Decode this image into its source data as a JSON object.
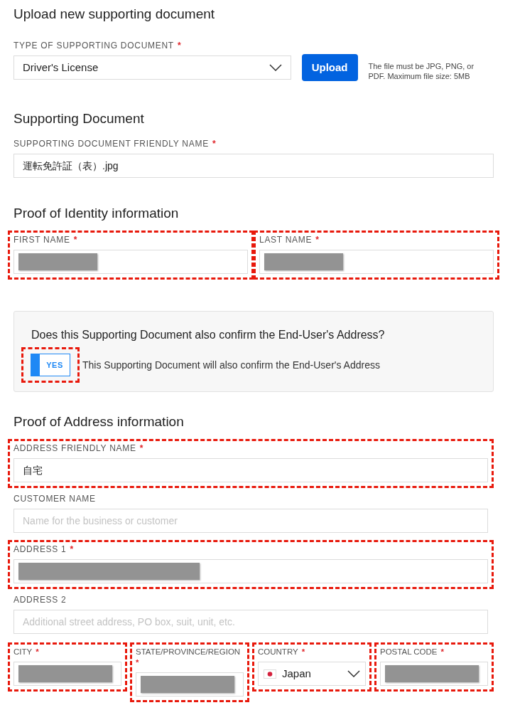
{
  "upload_section": {
    "title": "Upload new supporting document",
    "type_field": {
      "kind": "select",
      "label": "TYPE OF SUPPORTING DOCUMENT",
      "required_mark": "*",
      "value": "Driver's License",
      "highlighted": false
    },
    "upload_button": "Upload",
    "hint": "The file must be JPG, PNG, or PDF. Maximum file size: 5MB"
  },
  "document_section": {
    "title": "Supporting Document",
    "fields": [
      {
        "kind": "text",
        "label": "SUPPORTING DOCUMENT FRIENDLY NAME",
        "required_mark": "*",
        "value": "運転免許証（表）.jpg",
        "highlighted": false
      }
    ]
  },
  "identity_section": {
    "title": "Proof of Identity information",
    "fields": [
      {
        "kind": "text",
        "label": "FIRST NAME",
        "required_mark": "*",
        "redacted": true,
        "highlighted": true
      },
      {
        "kind": "text",
        "label": "LAST NAME",
        "required_mark": "*",
        "redacted": true,
        "highlighted": true
      }
    ]
  },
  "address_confirmation": {
    "question": "Does this Supporting Document also confirm the End-User's Address?",
    "toggle": {
      "label": "YES",
      "on": true,
      "highlighted": true
    },
    "description": "This Supporting Document will also confirm the End-User's Address"
  },
  "address_section": {
    "title": "Proof of Address information",
    "fields": [
      {
        "kind": "text",
        "label": "ADDRESS FRIENDLY NAME",
        "required_mark": "*",
        "value": "自宅",
        "highlighted": true
      },
      {
        "kind": "text",
        "label": "CUSTOMER NAME",
        "placeholder": "Name for the business or customer",
        "highlighted": false
      },
      {
        "kind": "text",
        "label": "ADDRESS 1",
        "required_mark": "*",
        "redacted": true,
        "highlighted": true
      },
      {
        "kind": "text",
        "label": "ADDRESS 2",
        "placeholder": "Additional street address, PO box, suit, unit, etc.",
        "highlighted": false
      }
    ],
    "bottom_fields": [
      {
        "kind": "text",
        "label": "CITY",
        "required_mark": "*",
        "redacted": true,
        "highlighted": true
      },
      {
        "kind": "text",
        "label": "STATE/PROVINCE/REGION",
        "required_mark": "*",
        "redacted": true,
        "highlighted": true
      },
      {
        "kind": "country",
        "label": "COUNTRY",
        "required_mark": "*",
        "value": "Japan",
        "highlighted": true
      },
      {
        "kind": "text",
        "label": "POSTAL CODE",
        "required_mark": "*",
        "redacted": true,
        "highlighted": true
      }
    ]
  }
}
